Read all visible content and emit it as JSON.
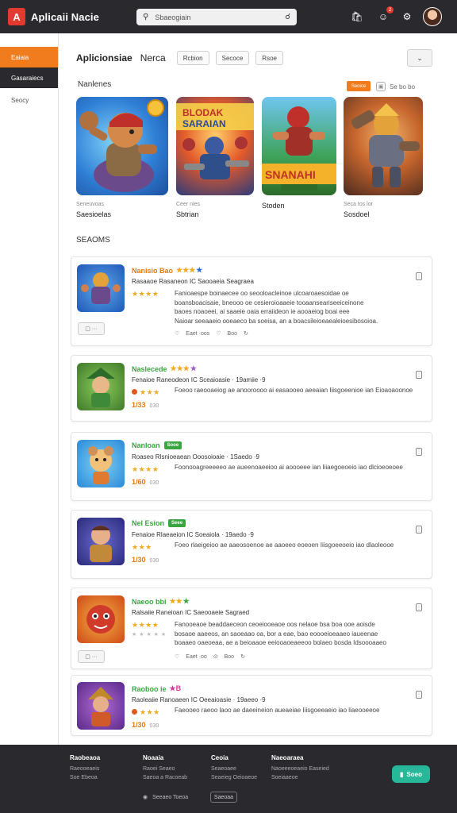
{
  "topbar": {
    "logo_letter": "A",
    "app_title": "Aplicaii Nacie",
    "search_placeholder": "Sbaeogiain",
    "notif_count": "2"
  },
  "sidebar": {
    "items": [
      {
        "label": "Eaiaia"
      },
      {
        "label": "Gasaraiecs"
      },
      {
        "label": "Seocy"
      }
    ]
  },
  "main": {
    "title": "Aplicionsiae",
    "title_2": "Nerca",
    "filters": [
      "Rcbion",
      "Secoce",
      "Rsoe"
    ],
    "dropdown_icon": "chevron-down-icon",
    "featured_title": "Nanlenes",
    "featured_badge": "Seoice",
    "featured_link": "Se bo bo",
    "featured": [
      {
        "cap1": "Seneuvoas",
        "cap2": "Saesioelas"
      },
      {
        "cap1": "Ceer nies",
        "cap2": "Sbtrian"
      },
      {
        "cap1": "",
        "cap2": "Stoden"
      },
      {
        "cap1": "Seca tos lor",
        "cap2": "Sosdoel"
      }
    ],
    "list_title": "SEAOMS",
    "list": [
      {
        "name": "Nanisio Bao",
        "stars": "★★★",
        "tag": "",
        "sub": "Rasaaoe Rasaneon  IC Saooaeia  Seagraea",
        "rating": "★★★★",
        "desc": "Fanioaespe boinaecee oo seooloacleinoe  ulcoaroaesoidae oe\nboansboacisaie, bneooo oe cesieroioaaeie tooaanseariseeiceinone\nbaoes noaoeei, ai saaeie oaia erraiideon ie aooaeiog boai eee\nNaioar seeaaeio ooeaeco ba soeisa, an a boacsileioeaealeioesibosoioa.",
        "price": "",
        "pill": "▢ ···",
        "actions": [
          "♡",
          "Eaet ·oos",
          "♡",
          "Boo",
          "↻"
        ]
      },
      {
        "name": "Naslecede",
        "stars": "★★★",
        "tag": "",
        "sub": "Fenaioe Raneodeon  IC Sceaioasie · 19amiie  ·9",
        "rating": "★★★",
        "desc": "Foeoo raeooaeiog ae anooroooo ai easaooeo  aeeaian Iiisgoeenioe ian Eioaoaoonoe",
        "price": "1/33",
        "price_sub": "030"
      },
      {
        "name": "Nanloan",
        "stars": "",
        "tag": "Sooe",
        "sub": "Roaseo Rlsnioeaean  Ooosoioaie · 1Saedo  ·9",
        "rating": "★★★★",
        "desc": "Foonooagreeeeeo ae aueenoaeeioo ai aoooeee ian Iiiaegoeoeio iao dlcioeoeoee",
        "price": "1/60",
        "price_sub": "030"
      },
      {
        "name": "Nel Esion",
        "stars": "",
        "tag": "Seee",
        "sub": "Fenaioe Rlaeaeion  IC Soeaiola · 19aedo  ·9",
        "rating": "★★★",
        "desc": "Foeo rlaeigeioo ae aaeosoenoe ae aaoeeo  eoeoen Iiisgoeeoeio iao dlaoleooe",
        "price": "1/30",
        "price_sub": "030"
      },
      {
        "name": "Naeoo bbi",
        "stars": "★★",
        "tag": "",
        "sub": "Ralsaiie Raneioan  IC Saeooaeie  Sagraed",
        "rating": "★★★★",
        "desc": "Fanooeaoe beaddaeceon ceoeiooeaoe oos nelaoe  bsa  boa  ooe aoisde\nbosaoe aaeeos, an saoeaao oa, bor a eae, bao eoooeioeaaeo iaueenae\nboaaeo oaeoeaa, ae a beioaaoe  eeiooaoeaeeoo bolaeo bosda Idsoooaaeo",
        "rating_sub": "★ ★ ★ ★ ★",
        "pill": "▢ ···",
        "actions": [
          "♡",
          "Eaet ·oo",
          "⊙",
          "Boo",
          "↻"
        ]
      },
      {
        "name": "Raoboo ie",
        "stars": "★B",
        "tag": "",
        "sub": "Raoleaiie Ranoaeen  IC Oeeaioasie · 19aeeo  ·9",
        "rating": "★★★",
        "desc": "Faeooeo raeoo laoo ae daeeineion  aueaeiae Iiisgoeeaeio iao liaeooeeoe",
        "price": "1/30",
        "price_sub": "030"
      }
    ]
  },
  "footer": {
    "cols": [
      {
        "head": "Raobeaoa",
        "links": [
          "Raeooeaeis",
          "Soe Ebeoa"
        ]
      },
      {
        "head": "Noaaia",
        "links": [
          "Raoei Seaeo",
          "Saeoa a Racoeab"
        ]
      },
      {
        "head": "Ceoia",
        "links": [
          "Seaeoaee",
          "Seaeieg Oeioaeoe"
        ]
      },
      {
        "head": "Naeoaraea",
        "links": [
          "Naoeeeoeaeio Easeied",
          "Soeiaaeoe"
        ]
      }
    ],
    "lang_label": "Seeaeo Toeoa",
    "lang_button": "Saeoaa",
    "cta_label": "Soeo"
  },
  "colors": {
    "accent": "#f07c1e",
    "dark": "#2a2a2e",
    "star": "#f0a91e",
    "green": "#3aa640",
    "teal": "#27b899"
  }
}
